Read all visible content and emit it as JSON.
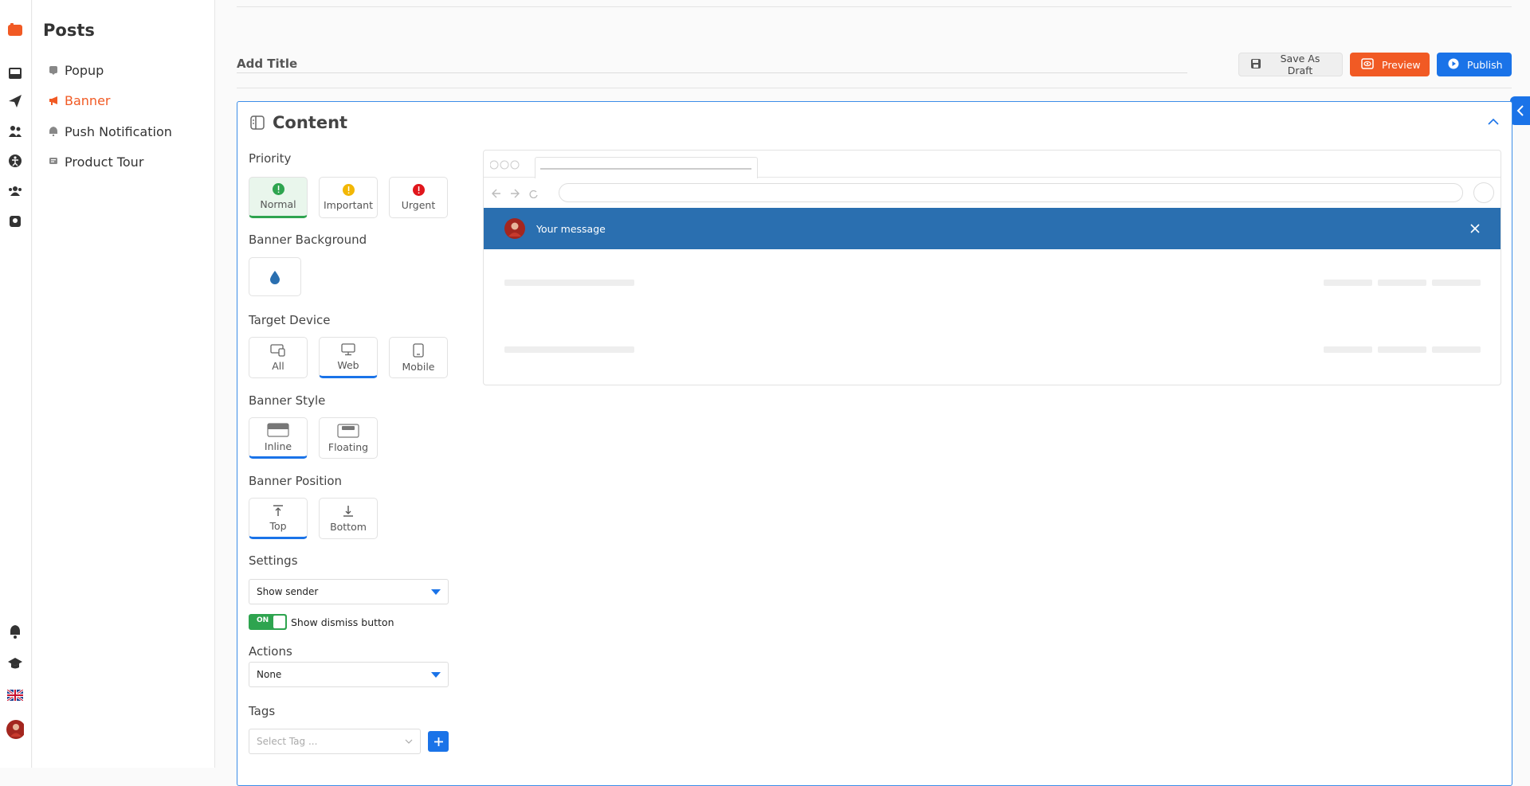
{
  "sidebar": {
    "title": "Posts",
    "items": [
      {
        "label": "Popup",
        "icon": "popup-icon"
      },
      {
        "label": "Banner",
        "icon": "megaphone-icon"
      },
      {
        "label": "Push Notification",
        "icon": "bell-icon"
      },
      {
        "label": "Product Tour",
        "icon": "tour-icon"
      }
    ]
  },
  "rail_icons": [
    "logo-icon",
    "inbox-icon",
    "send-icon",
    "users-icon",
    "accessibility-icon",
    "group-icon",
    "support-icon",
    "notification-bell-icon",
    "academy-icon",
    "uk-flag-icon",
    "avatar"
  ],
  "header": {
    "title_placeholder": "Add Title",
    "save_draft_label": "Save As Draft",
    "preview_label": "Preview",
    "publish_label": "Publish"
  },
  "content": {
    "section_title": "Content",
    "priority": {
      "label": "Priority",
      "options": [
        "Normal",
        "Important",
        "Urgent"
      ],
      "selected": "Normal"
    },
    "banner_background": {
      "label": "Banner Background",
      "color": "#2a6fb0"
    },
    "target_device": {
      "label": "Target Device",
      "options": [
        "All",
        "Web",
        "Mobile"
      ],
      "selected": "Web"
    },
    "banner_style": {
      "label": "Banner Style",
      "options": [
        "Inline",
        "Floating"
      ],
      "selected": "Inline"
    },
    "banner_position": {
      "label": "Banner Position",
      "options": [
        "Top",
        "Bottom"
      ],
      "selected": "Top"
    },
    "settings": {
      "label": "Settings",
      "sender_value": "Show sender",
      "toggle_state": "ON",
      "toggle_label": "Show dismiss button"
    },
    "actions": {
      "label": "Actions",
      "value": "None"
    },
    "tags": {
      "label": "Tags",
      "placeholder": "Select Tag ..."
    }
  },
  "preview": {
    "message": "Your message",
    "banner_color": "#2a6fb0"
  },
  "colors": {
    "accent_orange": "#f15a24",
    "accent_blue": "#1a73e8",
    "success_green": "#2ea44f"
  }
}
